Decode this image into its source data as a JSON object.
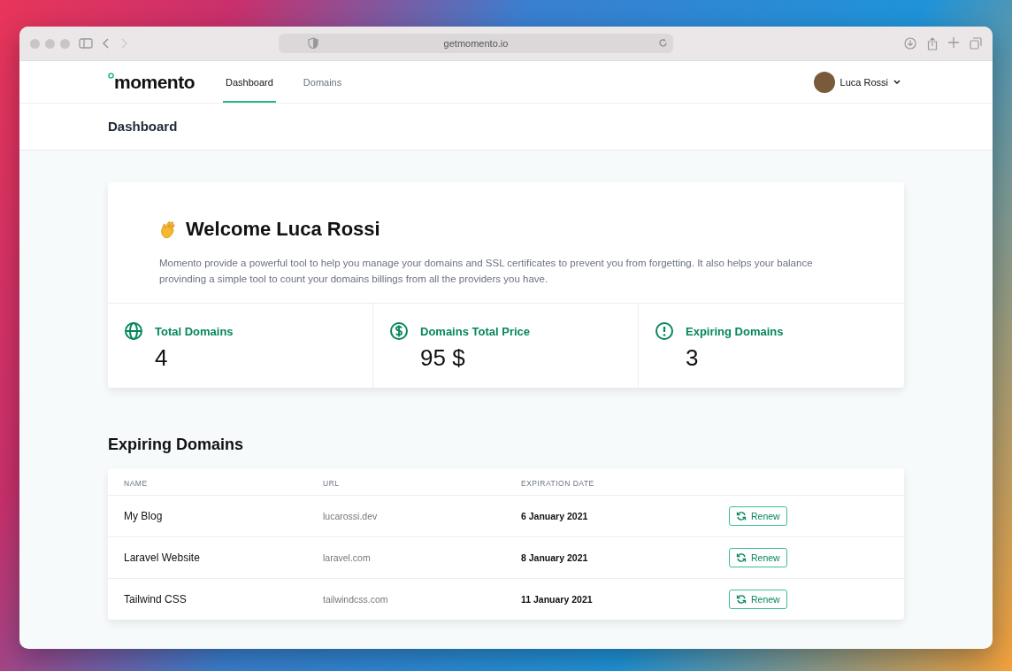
{
  "browser": {
    "address": "getmomento.io"
  },
  "nav": {
    "logo": "momento",
    "tabs": [
      {
        "label": "Dashboard",
        "selected": true
      },
      {
        "label": "Domains",
        "selected": false
      }
    ],
    "user": {
      "name": "Luca Rossi"
    }
  },
  "page_title": "Dashboard",
  "welcome": {
    "title": "Welcome Luca Rossi",
    "text": "Momento provide a powerful tool to help you manage your domains and SSL certificates to prevent you from forgetting. It also helps your balance provinding a simple tool to count your domains billings from all the providers you have."
  },
  "stats": [
    {
      "kind": "globe",
      "label": "Total Domains",
      "value": "4"
    },
    {
      "kind": "dollar",
      "label": "Domains Total Price",
      "value": "95 $"
    },
    {
      "kind": "alert",
      "label": "Expiring Domains",
      "value": "3"
    }
  ],
  "expiring": {
    "title": "Expiring Domains",
    "columns": [
      "NAME",
      "URL",
      "EXPIRATION DATE"
    ],
    "rows": [
      {
        "name": "My Blog",
        "url": "lucarossi.dev",
        "date": "6 January 2021",
        "action": "Renew"
      },
      {
        "name": "Laravel Website",
        "url": "laravel.com",
        "date": "8 January 2021",
        "action": "Renew"
      },
      {
        "name": "Tailwind CSS",
        "url": "tailwindcss.com",
        "date": "11 January 2021",
        "action": "Renew"
      }
    ]
  }
}
